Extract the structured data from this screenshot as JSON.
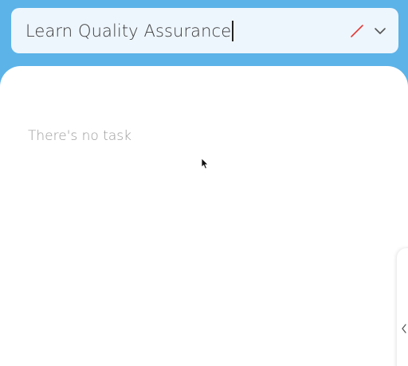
{
  "task": {
    "input_value": "Learn Quality Assurance",
    "priority_icon": "slash-icon",
    "priority_color": "#e53935",
    "dropdown_icon": "chevron-down-icon"
  },
  "list": {
    "empty_message": "There's no task"
  },
  "drawer": {
    "toggle_icon": "chevron-left-icon"
  },
  "colors": {
    "background": "#5cb3e8",
    "input_background": "#eef6fd",
    "panel_background": "#ffffff"
  }
}
